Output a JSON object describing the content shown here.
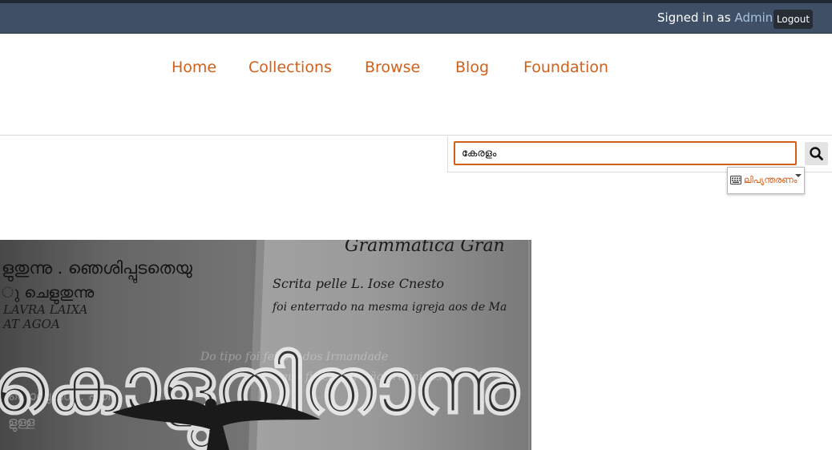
{
  "admin_bar": {
    "signed_in_prefix": "Signed in as ",
    "user": "Admin",
    "logout_label": "Logout"
  },
  "nav": {
    "items": [
      {
        "label": "Home"
      },
      {
        "label": "Collections"
      },
      {
        "label": "Browse"
      },
      {
        "label": "Blog"
      },
      {
        "label": "Foundation"
      }
    ]
  },
  "search": {
    "value": "കേരളം",
    "button_icon": "search-icon"
  },
  "transliteration": {
    "icon": "keyboard-icon",
    "label": "ലിപ്യന്തരണം"
  },
  "hero": {
    "image_text": {
      "top_left": [
        "ളുതുന്നു . ഞെശിപ്പുടതെയു",
        "ു ചെളുതുന്നു",
        "LAVRA LAIXA",
        "AT AGOA"
      ],
      "top_right": [
        "Grammatica Gran",
        "Scrita pelle L. Iose Cnesto",
        "foi enterrado na mesma igreja aos de Ma"
      ],
      "big": "കൊളുതിതാന്നു"
    }
  },
  "colors": {
    "accent": "#d2601a",
    "admin_bar": "#3f5066",
    "logout_bg": "#272d35"
  }
}
